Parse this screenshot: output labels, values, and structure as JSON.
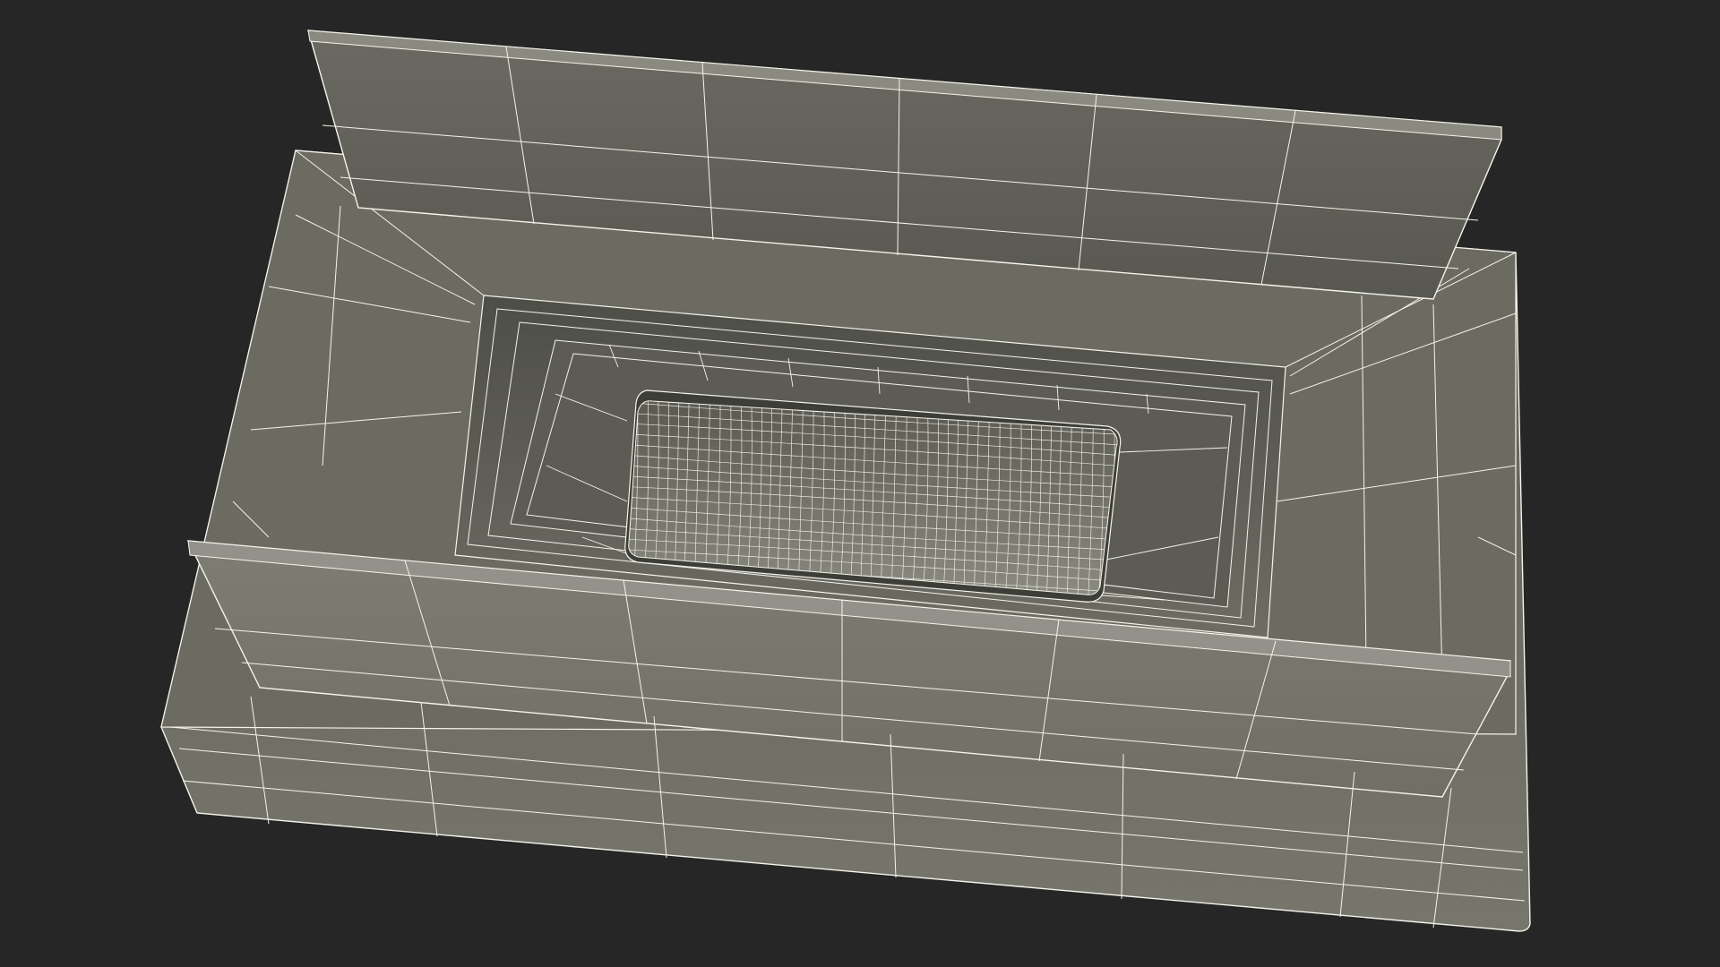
{
  "scene": {
    "subject": "wireframe-render-open-box",
    "colors": {
      "background": "#262626",
      "wire": "#f4f4ec",
      "surface_light": "#7a7a70",
      "surface_mid": "#6c6c63",
      "surface_dark": "#55554d",
      "surface_deep": "#3f3f3a",
      "tray_floor": "#828279"
    },
    "text": []
  }
}
